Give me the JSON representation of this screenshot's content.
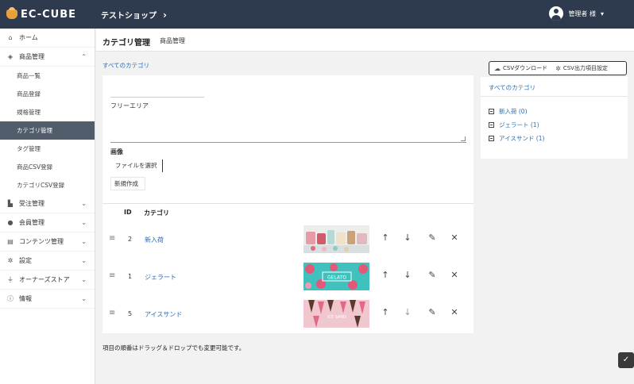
{
  "topbar": {
    "logo": "EC-CUBE",
    "shop_name": "テストショップ",
    "user_name": "管理者 様"
  },
  "sidebar": {
    "items": [
      {
        "label": "ホーム",
        "icon": "home-icon"
      },
      {
        "label": "商品管理",
        "icon": "tag-icon",
        "expanded": true
      },
      {
        "label": "受注管理",
        "icon": "cart-icon"
      },
      {
        "label": "会員管理",
        "icon": "users-icon"
      },
      {
        "label": "コンテンツ管理",
        "icon": "file-icon"
      },
      {
        "label": "設定",
        "icon": "gear-icon"
      },
      {
        "label": "オーナーズストア",
        "icon": "plug-icon"
      },
      {
        "label": "情報",
        "icon": "info-icon"
      }
    ],
    "sub_items": [
      {
        "label": "商品一覧"
      },
      {
        "label": "商品登録"
      },
      {
        "label": "規格管理"
      },
      {
        "label": "カテゴリ管理",
        "active": true
      },
      {
        "label": "タグ管理"
      },
      {
        "label": "商品CSV登録"
      },
      {
        "label": "カテゴリCSV登録"
      }
    ]
  },
  "header": {
    "title": "カテゴリ管理",
    "subtitle": "商品管理"
  },
  "breadcrumb": "すべてのカテゴリ",
  "form": {
    "free_area_label": "フリーエリア",
    "image_label": "画像",
    "file_button": "ファイルを選択",
    "create_button": "新規作成"
  },
  "table": {
    "col_id": "ID",
    "col_category": "カテゴリ",
    "rows": [
      {
        "id": "2",
        "name": "新入荷",
        "thumb_label": ""
      },
      {
        "id": "1",
        "name": "ジェラート",
        "thumb_label": "GELATO"
      },
      {
        "id": "5",
        "name": "アイスサンド",
        "thumb_label": "ICE SAND"
      }
    ]
  },
  "note": "項目の順番はドラッグ＆ドロップでも変更可能です。",
  "csv": {
    "download": "CSVダウンロード",
    "settings": "CSV出力項目設定"
  },
  "tree": {
    "head": "すべてのカテゴリ",
    "items": [
      {
        "label": "新入荷 (0)"
      },
      {
        "label": "ジェラート (1)"
      },
      {
        "label": "アイスサンド (1)"
      }
    ]
  },
  "colors": {
    "topbar": "#2e3a4e",
    "link": "#2b6cb0",
    "active_nav": "#525d6b"
  }
}
